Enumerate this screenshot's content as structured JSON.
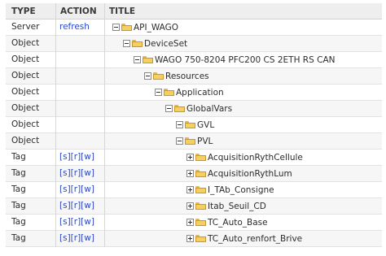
{
  "columns": {
    "type": "TYPE",
    "action": "ACTION",
    "title": "TITLE"
  },
  "rows": [
    {
      "type": "Server",
      "action": "refresh",
      "title": "API_WAGO",
      "toggle": "minus"
    },
    {
      "type": "Object",
      "action": "",
      "title": "DeviceSet",
      "toggle": "minus"
    },
    {
      "type": "Object",
      "action": "",
      "title": "WAGO 750-8204 PFC200 CS 2ETH RS CAN",
      "toggle": "minus"
    },
    {
      "type": "Object",
      "action": "",
      "title": "Resources",
      "toggle": "minus"
    },
    {
      "type": "Object",
      "action": "",
      "title": "Application",
      "toggle": "minus"
    },
    {
      "type": "Object",
      "action": "",
      "title": "GlobalVars",
      "toggle": "minus"
    },
    {
      "type": "Object",
      "action": "",
      "title": "GVL",
      "toggle": "minus"
    },
    {
      "type": "Object",
      "action": "",
      "title": "PVL",
      "toggle": "minus"
    },
    {
      "type": "Tag",
      "action": "[s][r][w]",
      "title": "AcquisitionRythCellule",
      "toggle": "plus"
    },
    {
      "type": "Tag",
      "action": "[s][r][w]",
      "title": "AcquisitionRythLum",
      "toggle": "plus"
    },
    {
      "type": "Tag",
      "action": "[s][r][w]",
      "title": "I_TAb_Consigne",
      "toggle": "plus"
    },
    {
      "type": "Tag",
      "action": "[s][r][w]",
      "title": "Itab_Seuil_CD",
      "toggle": "plus"
    },
    {
      "type": "Tag",
      "action": "[s][r][w]",
      "title": "TC_Auto_Base",
      "toggle": "plus"
    },
    {
      "type": "Tag",
      "action": "[s][r][w]",
      "title": "TC_Auto_renfort_Brive",
      "toggle": "plus"
    }
  ],
  "colors": {
    "folder": "#f5cf62",
    "folder_border": "#c9962a",
    "link": "#2b47c4",
    "header_bg": "#eeeeee"
  },
  "icons": {
    "folder": "folder-icon",
    "collapse": "collapse-toggle-icon",
    "expand": "expand-toggle-icon"
  }
}
